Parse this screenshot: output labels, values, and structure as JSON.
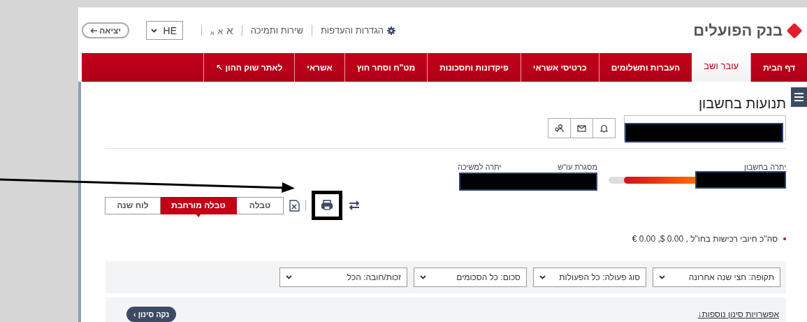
{
  "header": {
    "logo": "בנק הפועלים",
    "settings_link": "הגדרות והעדפות",
    "support_link": "שירות ותמיכה",
    "font_sizes": [
      "א",
      "א",
      "א"
    ],
    "language": "HE",
    "exit_button": "יציאה"
  },
  "nav": {
    "tabs": [
      {
        "label": "דף הבית",
        "selected": false
      },
      {
        "label": "עובר ושב",
        "selected": true
      },
      {
        "label": "העברות ותשלומים",
        "selected": false
      },
      {
        "label": "כרטיסי אשראי",
        "selected": false
      },
      {
        "label": "פיקדונות וחסכונות",
        "selected": false
      },
      {
        "label": "מט\"ח וסחר חוץ",
        "selected": false
      },
      {
        "label": "אשראי",
        "selected": false
      },
      {
        "label": "לאתר שוק ההון ↖",
        "selected": false
      }
    ]
  },
  "page": {
    "title": "תנועות בחשבון",
    "account_select": {
      "redacted": true
    },
    "balances": [
      {
        "label": "יתרה בחשבון",
        "redacted": true,
        "level": 0.82
      },
      {
        "label": "מסגרת עו\"ש",
        "redacted": true
      },
      {
        "label": "יתרה למשיכה"
      }
    ],
    "views": [
      {
        "label": "טבלה",
        "selected": false
      },
      {
        "label": "טבלה מורחבת",
        "selected": true
      },
      {
        "label": "לוח שנה",
        "selected": false
      }
    ],
    "print": {
      "highlighted": true
    },
    "annotation": {
      "kind": "arrow"
    },
    "notice": "סה\"כ חיובי רכישות בחו\"ל , 0.00 $, 0.00 €",
    "filters": [
      {
        "label": "תקופה: חצי שנה אחרונה"
      },
      {
        "label": "סוג פעולה: כל הפעולות"
      },
      {
        "label": "סכום: כל הסכומים"
      },
      {
        "label": "זכות/חובה: הכל"
      }
    ],
    "more_filters_link": "אפשרויות סינון נוספות↓",
    "clear_button": "נקה סינון ›"
  }
}
